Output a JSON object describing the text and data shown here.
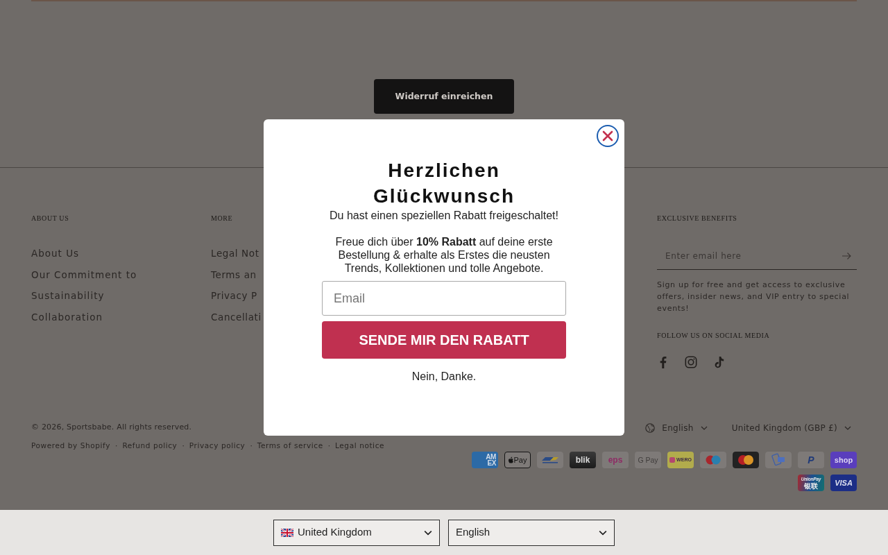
{
  "page": {
    "button": "Widerruf einreichen"
  },
  "footer": {
    "columns": [
      {
        "heading": "ABOUT US",
        "links": [
          "About Us",
          "Our Commitment to Sustainability",
          "Collaboration"
        ]
      },
      {
        "heading": "MORE",
        "links": [
          "Legal Not",
          "Terms an",
          "Privacy P",
          "Cancellati"
        ]
      }
    ],
    "newsletter": {
      "heading": "EXCLUSIVE BENEFITS",
      "placeholder": "Enter email here",
      "text": "Sign up for free and get access to exclusive offers, insider news, and VIP entry to special events!"
    },
    "social": {
      "heading": "FOLLOW US ON SOCIAL MEDIA",
      "icons": [
        {
          "kind": "facebook"
        },
        {
          "kind": "instagram"
        },
        {
          "kind": "tiktok"
        }
      ]
    },
    "copyright": "© 2026, Sportsbabe. All rights reserved.",
    "policy_links": [
      "Powered by Shopify",
      "Refund policy",
      "Privacy policy",
      "Terms of service",
      "Legal notice"
    ],
    "separator": "·",
    "language": "English",
    "country": "United Kingdom (GBP £)",
    "payments": [
      {
        "kind": "amex",
        "lines": [
          "AM",
          "EX"
        ]
      },
      {
        "kind": "applepay",
        "lines": [
          "Pay"
        ]
      },
      {
        "kind": "bancontact"
      },
      {
        "kind": "blik",
        "lines": [
          "blik"
        ]
      },
      {
        "kind": "eps",
        "lines": [
          "eps"
        ]
      },
      {
        "kind": "googlepay",
        "lines": [
          "G Pay"
        ]
      },
      {
        "kind": "wero",
        "lines": [
          "WERO"
        ]
      },
      {
        "kind": "maestro"
      },
      {
        "kind": "mastercard"
      },
      {
        "kind": "card"
      },
      {
        "kind": "paypal",
        "lines": [
          "P"
        ]
      },
      {
        "kind": "shop",
        "lines": [
          "shop"
        ]
      },
      {
        "kind": "unionpay",
        "lines": [
          "UnionPay",
          "银联"
        ]
      },
      {
        "kind": "visa",
        "lines": [
          "VISA"
        ]
      }
    ]
  },
  "popup": {
    "title": "Herzlichen Glückwunsch",
    "subtitle": "Du hast einen speziellen Rabatt freigeschaltet!",
    "text": "Freue dich über **10% Rabatt** auf deine erste Bestellung & erhalte als Erstes die neusten Trends, Kollektionen und tolle Angebote.",
    "placeholder": "Email",
    "button": "SENDE MIR DEN RABATT",
    "decline": "Nein, Danke."
  },
  "locale_bar": {
    "country": "United Kingdom",
    "language": "English"
  }
}
